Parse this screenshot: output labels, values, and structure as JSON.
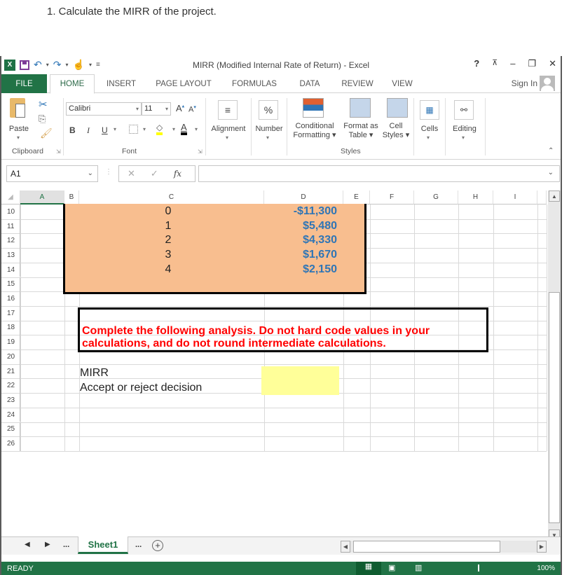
{
  "question": "1. Calculate the MIRR of the project.",
  "window": {
    "title": "MIRR (Modified Internal Rate of Return) - Excel",
    "controls": [
      "?",
      "restore-ribbon",
      "minimize",
      "maximize",
      "close"
    ],
    "sign_in": "Sign In"
  },
  "tabs": [
    "FILE",
    "HOME",
    "INSERT",
    "PAGE LAYOUT",
    "FORMULAS",
    "DATA",
    "REVIEW",
    "VIEW"
  ],
  "ribbon": {
    "clipboard": {
      "paste": "Paste",
      "label": "Clipboard"
    },
    "font": {
      "name": "Calibri",
      "size": "11",
      "bold": "B",
      "italic": "I",
      "underline": "U",
      "font_color_glyph": "A",
      "grow": "A",
      "shrink": "A",
      "label": "Font"
    },
    "alignment": "Alignment",
    "number": "Number",
    "number_glyph": "%",
    "styles": {
      "conditional": "Conditional",
      "conditional2": "Formatting",
      "format_table": "Format as",
      "format_table2": "Table",
      "cell_styles": "Cell",
      "cell_styles2": "Styles",
      "label": "Styles"
    },
    "cells": "Cells",
    "editing": "Editing"
  },
  "formula_bar": {
    "name_box": "A1",
    "fx": "fx",
    "value": ""
  },
  "columns": [
    "A",
    "B",
    "C",
    "D",
    "E",
    "F",
    "G",
    "H",
    "I"
  ],
  "rows": [
    "10",
    "11",
    "12",
    "13",
    "14",
    "15",
    "16",
    "17",
    "18",
    "19",
    "20",
    "21",
    "22",
    "23",
    "24",
    "25",
    "26"
  ],
  "cash_flows": [
    {
      "year": "0",
      "cash_flow": "-$11,300"
    },
    {
      "year": "1",
      "cash_flow": "$5,480"
    },
    {
      "year": "2",
      "cash_flow": "$4,330"
    },
    {
      "year": "3",
      "cash_flow": "$1,670"
    },
    {
      "year": "4",
      "cash_flow": "$2,150"
    }
  ],
  "instruction": {
    "line1": "Complete the following analysis. Do not hard code values in your",
    "line2": "calculations, and do not round intermediate calculations."
  },
  "labels": {
    "mirr": "MIRR",
    "decision": "Accept or reject decision"
  },
  "sheet_tabs": {
    "active": "Sheet1",
    "ellipsis": "..."
  },
  "status": {
    "text": "READY",
    "zoom": "100%"
  }
}
